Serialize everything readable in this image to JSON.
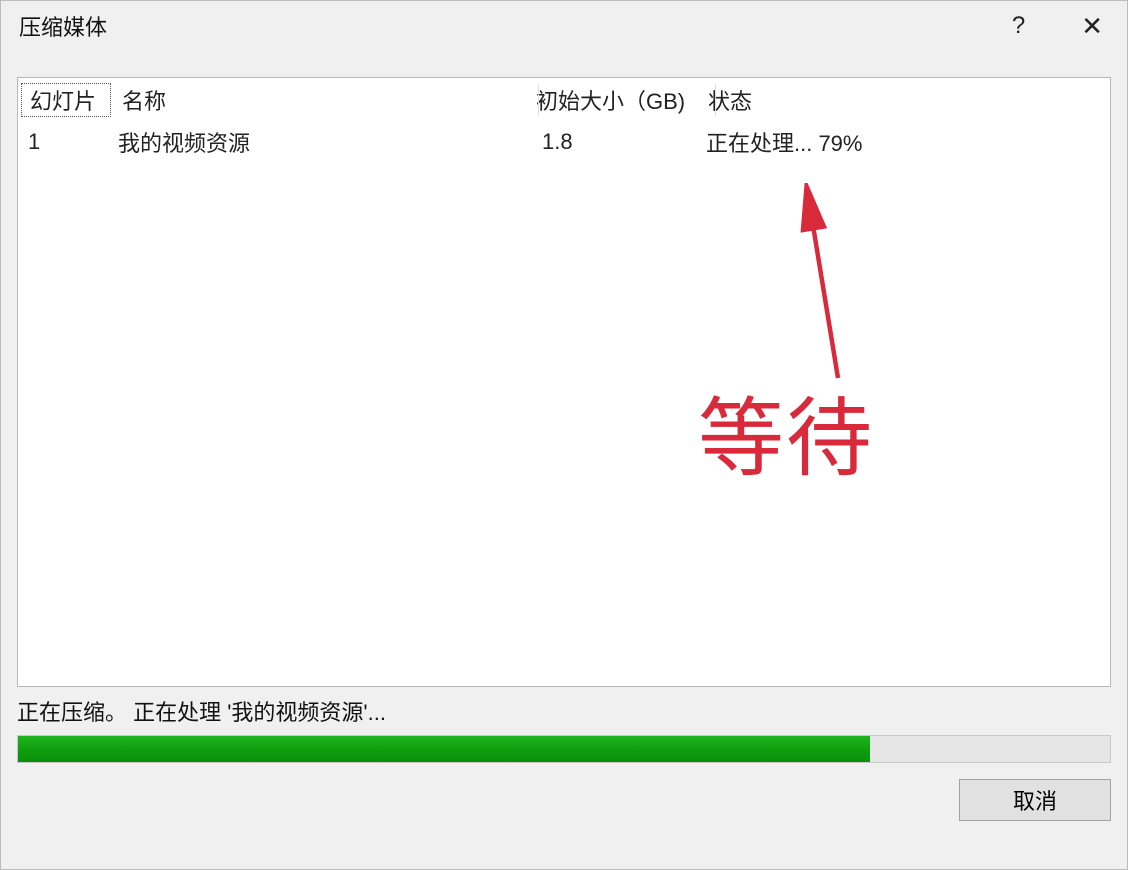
{
  "dialog": {
    "title": "压缩媒体",
    "help_symbol": "?",
    "close_symbol": "✕"
  },
  "table": {
    "headers": {
      "slide": "幻灯片",
      "name": "名称",
      "size": "初始大小（GB)",
      "status": "状态"
    },
    "row": {
      "slide": "1",
      "name": "我的视频资源",
      "size": "1.8",
      "status": "正在处理... 79%"
    }
  },
  "annotation": {
    "label": "等待"
  },
  "footer": {
    "status_text": "正在压缩。  正在处理 '我的视频资源'...",
    "progress_percent": 78,
    "cancel_label": "取消"
  }
}
